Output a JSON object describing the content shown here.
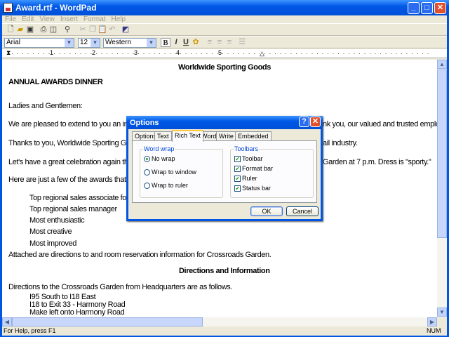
{
  "window": {
    "title": "Award.rtf - WordPad"
  },
  "menu": [
    "File",
    "Edit",
    "View",
    "Insert",
    "Format",
    "Help"
  ],
  "format_bar": {
    "font": "Arial",
    "size": "12",
    "script": "Western",
    "bold": "B",
    "italic": "I",
    "underline": "U"
  },
  "ruler": {
    "marks": [
      "1",
      "2",
      "3",
      "4",
      "5"
    ]
  },
  "document": {
    "heading1": "Worldwide Sporting Goods",
    "title": "ANNUAL AWARDS DINNER",
    "greeting": "Ladies and Gentlemen:",
    "p1_left": "We are pleased to extend to you an invi",
    "p1_right": "nk you, our valued and trusted employee",
    "p2_left": "Thanks to you, Worldwide Sporting Goo",
    "p2_right": "ail industry.",
    "p3_left": "Let's have a great celebration again thi",
    "p3_right": "Garden at 7 p.m. Dress is \"sporty.\"",
    "p4_left": "Here are just a few of the awards that w",
    "awards": [
      "Top regional sales associate for",
      "Top regional sales manager",
      "Most enthusiastic",
      "Most creative",
      "Most improved"
    ],
    "attached": "Attached are directions to and room reservation information for Crossroads Garden.",
    "heading2": "Directions and Information",
    "directions_intro": "Directions to the Crossroads Garden from Headquarters are as follows.",
    "directions": [
      "I95 South to I18 East",
      "I18 to Exit 33 - Harmony Road",
      "Make left onto Harmony Road"
    ]
  },
  "status": {
    "help": "For Help, press F1",
    "num": "NUM"
  },
  "dialog": {
    "title": "Options",
    "tabs": [
      "Options",
      "Text",
      "Rich Text",
      "Word",
      "Write",
      "Embedded"
    ],
    "selected_tab": "Rich Text",
    "word_wrap": {
      "label": "Word wrap",
      "options": [
        "No wrap",
        "Wrap to window",
        "Wrap to ruler"
      ],
      "selected": "No wrap"
    },
    "toolbars": {
      "label": "Toolbars",
      "items": [
        {
          "label": "Toolbar",
          "checked": true
        },
        {
          "label": "Format bar",
          "checked": true
        },
        {
          "label": "Ruler",
          "checked": true
        },
        {
          "label": "Status bar",
          "checked": true
        }
      ]
    },
    "ok": "OK",
    "cancel": "Cancel"
  }
}
